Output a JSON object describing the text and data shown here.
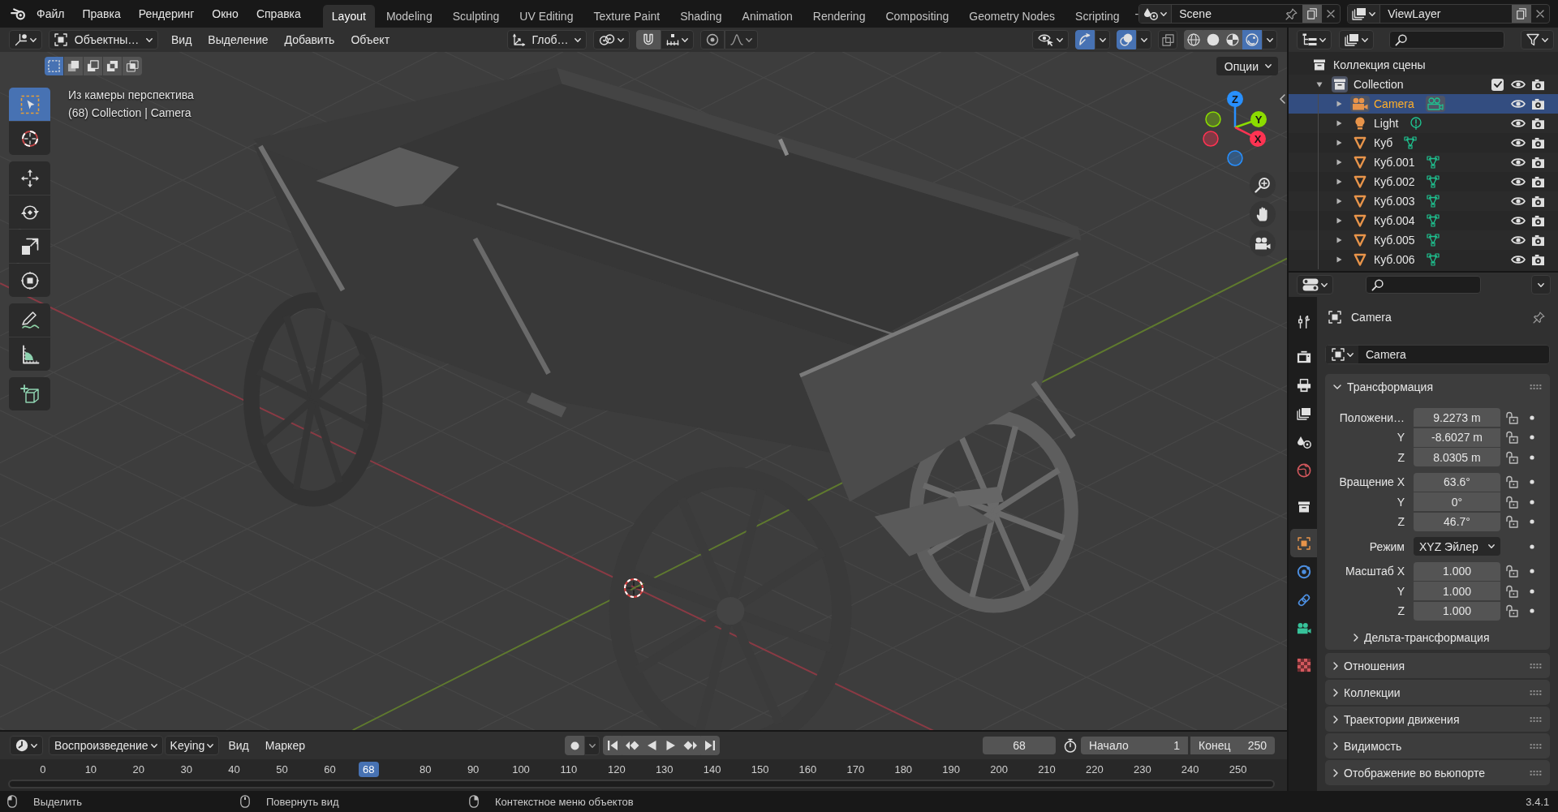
{
  "topbar": {
    "menus": [
      "Файл",
      "Правка",
      "Рендеринг",
      "Окно",
      "Справка"
    ],
    "workspaces": [
      {
        "label": "Layout",
        "selected": true
      },
      {
        "label": "Modeling",
        "selected": false
      },
      {
        "label": "Sculpting",
        "selected": false
      },
      {
        "label": "UV Editing",
        "selected": false
      },
      {
        "label": "Texture Paint",
        "selected": false
      },
      {
        "label": "Shading",
        "selected": false
      },
      {
        "label": "Animation",
        "selected": false
      },
      {
        "label": "Rendering",
        "selected": false
      },
      {
        "label": "Compositing",
        "selected": false
      },
      {
        "label": "Geometry Nodes",
        "selected": false
      },
      {
        "label": "Scripting",
        "selected": false
      }
    ],
    "overflow": "-",
    "scene": "Scene",
    "view_layer": "ViewLayer"
  },
  "viewport": {
    "header": {
      "mode": "Объектны…",
      "menus": [
        "Вид",
        "Выделение",
        "Добавить",
        "Объект"
      ],
      "orientation": "Глоб…",
      "gizmos": {
        "on": true
      },
      "overlays": {
        "on": true
      },
      "shading": [
        {
          "kind": "wireframe",
          "selected": false
        },
        {
          "kind": "solid",
          "selected": false
        },
        {
          "kind": "material",
          "selected": false
        },
        {
          "kind": "rendered",
          "selected": true
        }
      ]
    },
    "select_modes": [
      {
        "kind": "new",
        "selected": true
      },
      {
        "kind": "extend",
        "selected": false
      },
      {
        "kind": "subtract",
        "selected": false
      },
      {
        "kind": "invert",
        "selected": false
      },
      {
        "kind": "intersect",
        "selected": false
      }
    ],
    "options": "Опции",
    "overlay_text": [
      "Из камеры перспектива",
      "(68) Collection | Camera"
    ],
    "tools": [
      {
        "kind": "select_box",
        "selected": true
      },
      {
        "kind": "cursor",
        "selected": false
      },
      {
        "kind": "move",
        "selected": false
      },
      {
        "kind": "rotate",
        "selected": false
      },
      {
        "kind": "scale",
        "selected": false
      },
      {
        "kind": "transform",
        "selected": false
      },
      {
        "kind": "annotate",
        "selected": false
      },
      {
        "kind": "measure",
        "selected": false
      },
      {
        "kind": "add_cube",
        "selected": false
      }
    ],
    "gizmo_axes": [
      {
        "label": "Z",
        "color": "#2890ff"
      },
      {
        "label": "Y",
        "color": "#8bdc00"
      },
      {
        "label": "X",
        "color": "#ff3352"
      }
    ]
  },
  "outliner": {
    "root": "Коллекция сцены",
    "collection": {
      "name": "Collection",
      "expanded": true,
      "checked": true,
      "children": [
        {
          "name": "Camera",
          "kind": "camera",
          "selected": true,
          "expanded": false
        },
        {
          "name": "Light",
          "kind": "light",
          "selected": false,
          "expanded": false
        },
        {
          "name": "Куб",
          "kind": "mesh",
          "selected": false,
          "expanded": false
        },
        {
          "name": "Куб.001",
          "kind": "mesh",
          "selected": false,
          "expanded": false
        },
        {
          "name": "Куб.002",
          "kind": "mesh",
          "selected": false,
          "expanded": false
        },
        {
          "name": "Куб.003",
          "kind": "mesh",
          "selected": false,
          "expanded": false
        },
        {
          "name": "Куб.004",
          "kind": "mesh",
          "selected": false,
          "expanded": false
        },
        {
          "name": "Куб.005",
          "kind": "mesh",
          "selected": false,
          "expanded": false
        },
        {
          "name": "Куб.006",
          "kind": "mesh",
          "selected": false,
          "expanded": false
        }
      ]
    }
  },
  "properties": {
    "tabs": [
      {
        "kind": "tool",
        "selected": false
      },
      {
        "kind": "render",
        "selected": false
      },
      {
        "kind": "output",
        "selected": false
      },
      {
        "kind": "view_layer",
        "selected": false
      },
      {
        "kind": "scene",
        "selected": false
      },
      {
        "kind": "world",
        "selected": false
      },
      {
        "kind": "collection",
        "selected": false
      },
      {
        "kind": "object",
        "selected": true
      },
      {
        "kind": "physics",
        "selected": false
      },
      {
        "kind": "constraints",
        "selected": false
      },
      {
        "kind": "data",
        "selected": false
      },
      {
        "kind": "texture",
        "selected": false
      }
    ],
    "object_name": "Camera",
    "data_block": "Camera",
    "transform": {
      "title": "Трансформация",
      "expanded": true,
      "groups": [
        [
          {
            "label": "Положени…",
            "value": "9.2273 m",
            "kind": "number"
          },
          {
            "label": "Y",
            "value": "-8.6027 m",
            "kind": "number"
          },
          {
            "label": "Z",
            "value": "8.0305 m",
            "kind": "number"
          }
        ],
        [
          {
            "label": "Вращение X",
            "value": "63.6°",
            "kind": "number"
          },
          {
            "label": "Y",
            "value": "0°",
            "kind": "number"
          },
          {
            "label": "Z",
            "value": "46.7°",
            "kind": "number"
          }
        ],
        [
          {
            "label": "Режим",
            "value": "XYZ Эйлер",
            "kind": "dropdown"
          }
        ],
        [
          {
            "label": "Масштаб X",
            "value": "1.000",
            "kind": "number"
          },
          {
            "label": "Y",
            "value": "1.000",
            "kind": "number"
          },
          {
            "label": "Z",
            "value": "1.000",
            "kind": "number"
          }
        ]
      ],
      "subpanels": [
        {
          "title": "Дельта-трансформация",
          "expanded": false
        }
      ]
    },
    "panels": [
      {
        "title": "Отношения",
        "expanded": false
      },
      {
        "title": "Коллекции",
        "expanded": false
      },
      {
        "title": "Траектории движения",
        "expanded": false
      },
      {
        "title": "Видимость",
        "expanded": false
      },
      {
        "title": "Отображение во вьюпорте",
        "expanded": false
      }
    ]
  },
  "timeline": {
    "dropdowns": [
      "Воспроизведение",
      "Keying"
    ],
    "menus": [
      "Вид",
      "Маркер"
    ],
    "current_frame": "68",
    "start": {
      "label": "Начало",
      "value": "1"
    },
    "end": {
      "label": "Конец",
      "value": "250"
    },
    "ruler": [
      {
        "label": "0"
      },
      {
        "label": "10"
      },
      {
        "label": "20"
      },
      {
        "label": "30"
      },
      {
        "label": "40"
      },
      {
        "label": "50"
      },
      {
        "label": "60"
      },
      {
        "label": "68",
        "kind": "playhead"
      },
      {
        "label": "80"
      },
      {
        "label": "90"
      },
      {
        "label": "100"
      },
      {
        "label": "110"
      },
      {
        "label": "120"
      },
      {
        "label": "130"
      },
      {
        "label": "140"
      },
      {
        "label": "150"
      },
      {
        "label": "160"
      },
      {
        "label": "170"
      },
      {
        "label": "180"
      },
      {
        "label": "190"
      },
      {
        "label": "200"
      },
      {
        "label": "210"
      },
      {
        "label": "220"
      },
      {
        "label": "230"
      },
      {
        "label": "240"
      },
      {
        "label": "250"
      }
    ]
  },
  "status_bar": {
    "hints": [
      "Выделить",
      "Повернуть вид",
      "Контекстное меню объектов"
    ],
    "version": "3.4.1"
  }
}
